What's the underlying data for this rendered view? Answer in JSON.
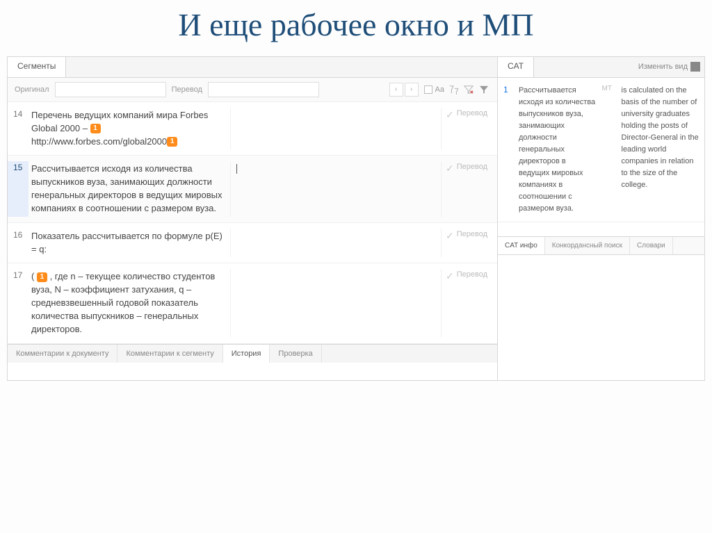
{
  "slide": {
    "title": "И еще рабочее окно и МП"
  },
  "left": {
    "tab": "Сегменты",
    "filter": {
      "source_label": "Оригинал",
      "target_label": "Перевод",
      "case_label": "Aa"
    },
    "status_label": "Перевод",
    "tag": "1",
    "segments": [
      {
        "num": "14",
        "source_parts": [
          "Перечень ведущих компаний мира Forbes Global 2000 – ",
          "TAG",
          "http://www.forbes.com/global2000",
          "TAG"
        ],
        "target": ""
      },
      {
        "num": "15",
        "source": "Рассчитывается исходя из количества выпускников вуза, занимающих должности генеральных директоров в ведущих мировых компаниях в соотношении с размером вуза.",
        "target_cursor": true,
        "active": true
      },
      {
        "num": "16",
        "source": "Показатель рассчитывается по формуле p(E) = q:",
        "target": ""
      },
      {
        "num": "17",
        "source_parts": [
          "( ",
          "TAG",
          " , где n – текущее количество студентов вуза, N – коэффициент затухания, q – средневзвешенный годовой показатель количества выпускников – генеральных директоров."
        ],
        "target": ""
      }
    ],
    "bottom_tabs": [
      "Комментарии к документу",
      "Комментарии к сегменту",
      "История",
      "Проверка"
    ],
    "bottom_active": 2
  },
  "right": {
    "tab": "CAT",
    "view_change": "Изменить вид",
    "match": {
      "num": "1",
      "source": "Рассчитывается исходя из количества выпускников вуза, занимающих должности генеральных директоров в ведущих мировых компаниях в соотношении с размером вуза.",
      "mt_label": "MT",
      "target": "is calculated on the basis of the number of university graduates holding the posts of Director-General in the leading world companies in relation to the size of the college."
    },
    "lower_tabs": [
      "CAT инфо",
      "Конкордансный поиск",
      "Словари"
    ],
    "lower_active": 0
  }
}
